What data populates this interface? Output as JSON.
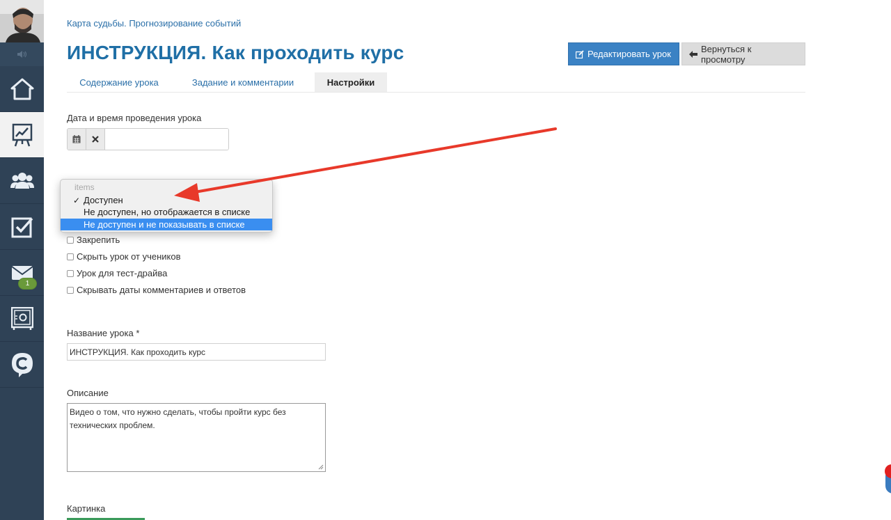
{
  "sidebar": {
    "items": [
      {
        "name": "home",
        "icon": "home-icon"
      },
      {
        "name": "training",
        "icon": "chart-board-icon",
        "active": true
      },
      {
        "name": "users",
        "icon": "users-icon"
      },
      {
        "name": "tasks",
        "icon": "checkbox-icon"
      },
      {
        "name": "messages",
        "icon": "envelope-icon",
        "badge": "1"
      },
      {
        "name": "safe",
        "icon": "safe-icon"
      },
      {
        "name": "brand",
        "icon": "brand-c-icon"
      }
    ],
    "sound_icon": "speaker-icon"
  },
  "header": {
    "breadcrumb": "Карта судьбы. Прогнозирование событий",
    "title": "ИНСТРУКЦИЯ. Как проходить курс",
    "edit_button": "Редактировать урок",
    "back_button": "Вернуться к просмотру"
  },
  "tabs": [
    {
      "label": "Содержание урока"
    },
    {
      "label": "Задание и комментарии"
    },
    {
      "label": "Настройки",
      "active": true
    }
  ],
  "form": {
    "datetime_label": "Дата и время проведения урока",
    "datetime_value": "",
    "select": {
      "header": "items",
      "options": [
        {
          "label": "Доступен",
          "checked": true
        },
        {
          "label": "Не доступен, но отображается в списке"
        },
        {
          "label": "Не доступен и не показывать в списке",
          "highlighted": true
        }
      ],
      "checkmark": "✓"
    },
    "checkboxes": [
      {
        "label": "Закрепить",
        "checked": false
      },
      {
        "label": "Скрыть урок от учеников",
        "checked": false
      },
      {
        "label": "Урок для тест-драйва",
        "checked": false
      },
      {
        "label": "Скрывать даты комментариев и ответов",
        "checked": false
      }
    ],
    "name_label": "Название урока *",
    "name_value": "ИНСТРУКЦИЯ. Как проходить курс",
    "description_label": "Описание",
    "description_value": "Видео о том, что нужно сделать, чтобы пройти курс без технических проблем.",
    "image_label": "Картинка"
  },
  "colors": {
    "sidebar_bg": "#2f4256",
    "accent_blue": "#1f6fa6",
    "primary_button": "#3b82c4",
    "highlight": "#3a8ef0",
    "annotation_arrow": "#e8392a",
    "badge_green": "#6a9a3a"
  }
}
